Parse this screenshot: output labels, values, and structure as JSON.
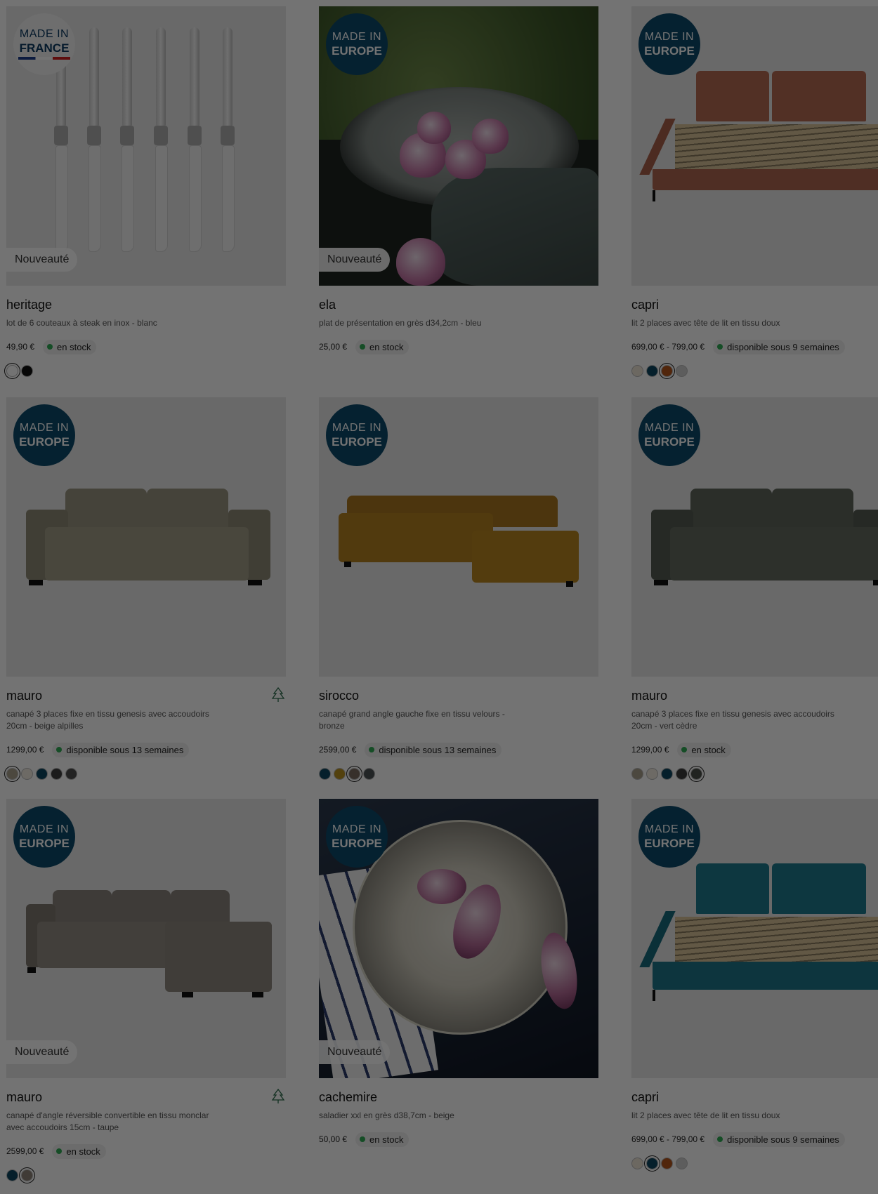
{
  "products": [
    {
      "name": "heritage",
      "description": "lot de 6 couteaux à steak en inox - blanc",
      "price": "49,90 €",
      "availability": "en stock",
      "badge": {
        "line1": "MADE IN",
        "line2": "FRANCE"
      },
      "new_label": "Nouveauté",
      "fsc": false,
      "swatches": [
        {
          "color": "#ffffff",
          "selected": true
        },
        {
          "color": "#111111",
          "selected": false
        }
      ]
    },
    {
      "name": "ela",
      "description": "plat de présentation en grès d34,2cm - bleu",
      "price": "25,00 €",
      "availability": "en stock",
      "badge": {
        "line1": "MADE IN",
        "line2": "EUROPE"
      },
      "new_label": "Nouveauté",
      "fsc": false,
      "swatches": []
    },
    {
      "name": "capri",
      "description": "lit 2 places avec tête de lit en tissu doux",
      "price": "699,00 € - 799,00 €",
      "availability": "disponible sous 9 semaines",
      "badge": {
        "line1": "MADE IN",
        "line2": "EUROPE"
      },
      "new_label": "",
      "fsc": false,
      "swatches": [
        {
          "color": "#efe6d8",
          "selected": false
        },
        {
          "color": "#0d4660",
          "selected": false
        },
        {
          "color": "#b4541c",
          "selected": true
        },
        {
          "color": "#cfcfcf",
          "selected": false
        }
      ]
    },
    {
      "name": "mauro",
      "description": "canapé 3 places fixe en tissu genesis avec accoudoirs 20cm - beige alpilles",
      "price": "1299,00 €",
      "availability": "disponible sous 13 semaines",
      "badge": {
        "line1": "MADE IN",
        "line2": "EUROPE"
      },
      "new_label": "",
      "fsc": true,
      "swatches": [
        {
          "color": "#a9a18c",
          "selected": true
        },
        {
          "color": "#f1ece1",
          "selected": false
        },
        {
          "color": "#0d4660",
          "selected": false
        },
        {
          "color": "#3c3c3c",
          "selected": false
        },
        {
          "color": "#4c4c4c",
          "selected": false
        }
      ]
    },
    {
      "name": "sirocco",
      "description": "canapé grand angle gauche fixe en tissu velours - bronze",
      "price": "2599,00 €",
      "availability": "disponible sous 13 semaines",
      "badge": {
        "line1": "MADE IN",
        "line2": "EUROPE"
      },
      "new_label": "",
      "fsc": false,
      "swatches": [
        {
          "color": "#0d4660",
          "selected": false
        },
        {
          "color": "#b9901f",
          "selected": false
        },
        {
          "color": "#7a6a60",
          "selected": true
        },
        {
          "color": "#4c5356",
          "selected": false
        }
      ]
    },
    {
      "name": "mauro",
      "description": "canapé 3 places fixe en tissu genesis avec accoudoirs 20cm - vert cèdre",
      "price": "1299,00 €",
      "availability": "en stock",
      "badge": {
        "line1": "MADE IN",
        "line2": "EUROPE"
      },
      "new_label": "",
      "fsc": false,
      "swatches": [
        {
          "color": "#a9a18c",
          "selected": false
        },
        {
          "color": "#f1ece1",
          "selected": false
        },
        {
          "color": "#0d4660",
          "selected": false
        },
        {
          "color": "#3c3c3c",
          "selected": false
        },
        {
          "color": "#4a4f48",
          "selected": true
        }
      ]
    },
    {
      "name": "mauro",
      "description": "canapé d'angle réversible convertible en tissu monclar avec accoudoirs 15cm - taupe",
      "price": "2599,00 €",
      "availability": "en stock",
      "badge": {
        "line1": "MADE IN",
        "line2": "EUROPE"
      },
      "new_label": "Nouveauté",
      "fsc": true,
      "swatches": [
        {
          "color": "#0d4660",
          "selected": false
        },
        {
          "color": "#8f8478",
          "selected": true
        }
      ]
    },
    {
      "name": "cachemire",
      "description": "saladier xxl en grès d38,7cm - beige",
      "price": "50,00 €",
      "availability": "en stock",
      "badge": {
        "line1": "MADE IN",
        "line2": "EUROPE"
      },
      "new_label": "Nouveauté",
      "fsc": false,
      "swatches": []
    },
    {
      "name": "capri",
      "description": "lit 2 places avec tête de lit en tissu doux",
      "price": "699,00 € - 799,00 €",
      "availability": "disponible sous 9 semaines",
      "badge": {
        "line1": "MADE IN",
        "line2": "EUROPE"
      },
      "new_label": "",
      "fsc": false,
      "swatches": [
        {
          "color": "#efe6d8",
          "selected": false
        },
        {
          "color": "#0d4660",
          "selected": true
        },
        {
          "color": "#b4541c",
          "selected": false
        },
        {
          "color": "#cfcfcf",
          "selected": false
        }
      ]
    }
  ]
}
